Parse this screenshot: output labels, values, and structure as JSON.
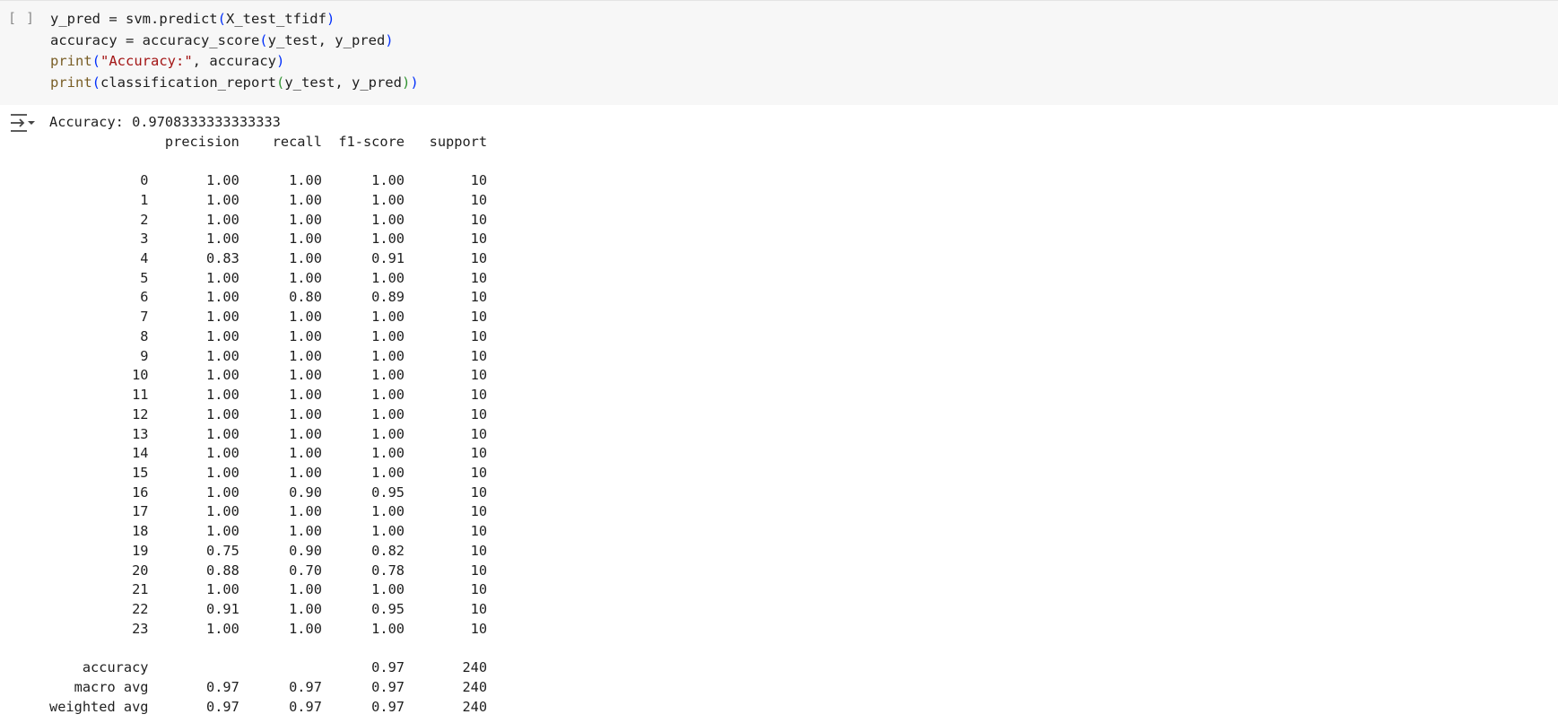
{
  "cell": {
    "run_label": "[ ]",
    "code": {
      "line1": {
        "a": "y_pred = svm.predict",
        "b": "(",
        "c": "X_test_tfidf",
        "d": ")"
      },
      "line2": {
        "a": "accuracy = accuracy_score",
        "b": "(",
        "c": "y_test, y_pred",
        "d": ")"
      },
      "line3": {
        "fn": "print",
        "b": "(",
        "str": "\"Accuracy:\"",
        "c": ", accuracy",
        "d": ")"
      },
      "line4": {
        "fn": "print",
        "b": "(",
        "c": "classification_report",
        "e": "(",
        "f": "y_test, y_pred",
        "g": ")",
        "d": ")"
      }
    }
  },
  "output": {
    "icon": "output-collapse-icon",
    "text": "Accuracy: 0.9708333333333333\n              precision    recall  f1-score   support\n\n           0       1.00      1.00      1.00        10\n           1       1.00      1.00      1.00        10\n           2       1.00      1.00      1.00        10\n           3       1.00      1.00      1.00        10\n           4       0.83      1.00      0.91        10\n           5       1.00      1.00      1.00        10\n           6       1.00      0.80      0.89        10\n           7       1.00      1.00      1.00        10\n           8       1.00      1.00      1.00        10\n           9       1.00      1.00      1.00        10\n          10       1.00      1.00      1.00        10\n          11       1.00      1.00      1.00        10\n          12       1.00      1.00      1.00        10\n          13       1.00      1.00      1.00        10\n          14       1.00      1.00      1.00        10\n          15       1.00      1.00      1.00        10\n          16       1.00      0.90      0.95        10\n          17       1.00      1.00      1.00        10\n          18       1.00      1.00      1.00        10\n          19       0.75      0.90      0.82        10\n          20       0.88      0.70      0.78        10\n          21       1.00      1.00      1.00        10\n          22       0.91      1.00      0.95        10\n          23       1.00      1.00      1.00        10\n\n    accuracy                           0.97       240\n   macro avg       0.97      0.97      0.97       240\nweighted avg       0.97      0.97      0.97       240"
  },
  "colors": {
    "code_background": "#f7f7f7",
    "function": "#795e26",
    "string": "#a31515",
    "bracket_level1": "#0431fa",
    "bracket_level2": "#319331"
  }
}
